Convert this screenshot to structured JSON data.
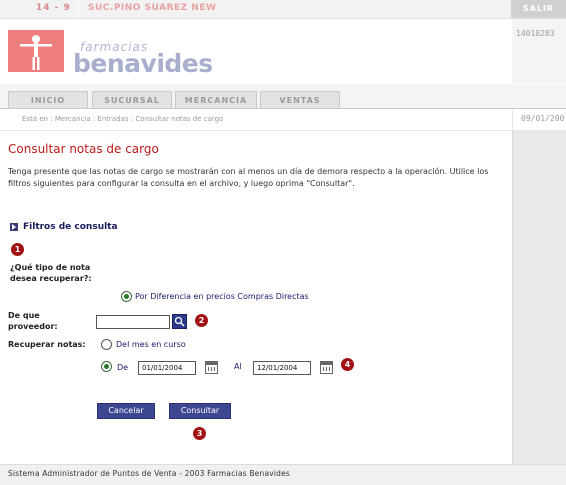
{
  "topbar": {
    "store_number": "14 - 9",
    "store_name": "SUC.PINO SUAREZ NEW",
    "exit_label": "SALIR"
  },
  "header": {
    "session_id": "14018283",
    "logo_line1": "farmacias",
    "logo_line2": "benavides"
  },
  "tabs": [
    {
      "label": "INICIO"
    },
    {
      "label": "SUCURSAL"
    },
    {
      "label": "MERCANCÍA"
    },
    {
      "label": "VENTAS"
    }
  ],
  "breadcrumb": {
    "text": "Está en : Mercancía : Entradas : Consultar notas de cargo",
    "date": "09/01/200"
  },
  "main": {
    "title": "Consultar notas de cargo",
    "intro": "Tenga presente que las notas de cargo se mostrarán con al menos un día de demora respecto a la operación. Utilice los filtros siguientes para configurar la consulta en el archivo, y luego oprima \"Consultar\".",
    "section_title": "Filtros de consulta",
    "note_type_label": "¿Qué tipo de nota desea recuperar?:",
    "note_type_option": "Por Diferencia en precios Compras Directas",
    "supplier_label": "De que proveedor:",
    "supplier_value": "",
    "recover_label": "Recuperar notas:",
    "option_month": "Del mes en curso",
    "option_from": "De",
    "date_from": "01/01/2004",
    "to_label": "Al",
    "date_to": "12/01/2004",
    "cancel_label": "Cancelar",
    "consult_label": "Consultar",
    "badges": [
      "1",
      "2",
      "3",
      "4"
    ]
  },
  "footer": {
    "text": "Sistema Administrador de Puntos de Venta - 2003 Farmacias Benavides"
  },
  "colors": {
    "title_red": "#bb1a1a",
    "button_blue": "#3d4690",
    "badge_red": "#a21212",
    "logo_pink": "#ef7f7f"
  }
}
